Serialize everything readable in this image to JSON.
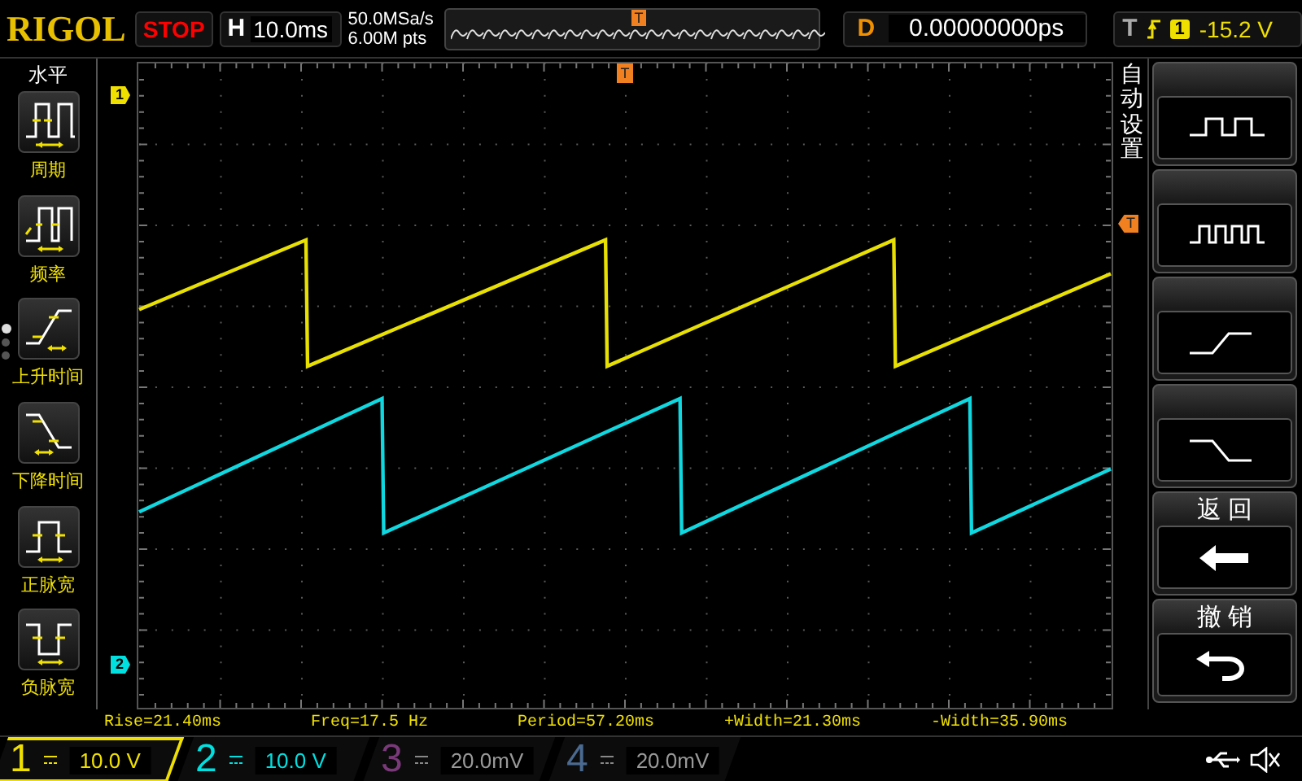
{
  "logo": "RIGOL",
  "run_state": {
    "label": "STOP"
  },
  "horizontal": {
    "label": "H",
    "value": "10.0ms"
  },
  "acquisition": {
    "sample_rate": "50.0MSa/s",
    "memory_depth": "6.00M pts"
  },
  "trigger_position_marker": "T",
  "delay": {
    "label": "D",
    "value": "0.00000000ps"
  },
  "trigger": {
    "label": "T",
    "source": "1",
    "level": "-15.2 V"
  },
  "left_menu": {
    "title": "水平",
    "page_dots": [
      {
        "selected": true
      },
      {
        "selected": false
      },
      {
        "selected": false
      }
    ],
    "items": [
      {
        "label": "周期",
        "kind": "period"
      },
      {
        "label": "频率",
        "kind": "frequency"
      },
      {
        "label": "上升时间",
        "kind": "rise"
      },
      {
        "label": "下降时间",
        "kind": "fall"
      },
      {
        "label": "正脉宽",
        "kind": "positive"
      },
      {
        "label": "负脉宽",
        "kind": "negative"
      }
    ]
  },
  "screen": {
    "channel_markers": [
      {
        "label": "1",
        "color": "#f0e000"
      },
      {
        "label": "2",
        "color": "#00e0e0"
      }
    ],
    "trigger_position_marker": "T"
  },
  "right_menu": {
    "title": "自动设置",
    "trigger_level_marker": "T",
    "keys": [
      {
        "kind": "single-pulse"
      },
      {
        "kind": "pulse-train"
      },
      {
        "kind": "rising-edge"
      },
      {
        "kind": "falling-edge"
      },
      {
        "kind": "back",
        "title": "返 回"
      },
      {
        "kind": "undo",
        "title": "撤 销"
      }
    ]
  },
  "measurements": [
    "Rise=21.40ms",
    "Freq=17.5 Hz",
    "Period=57.20ms",
    "+Width=21.30ms",
    "-Width=35.90ms"
  ],
  "channels": [
    {
      "number": "1",
      "value": "10.0 V",
      "color": "#f0e000",
      "enabled": true,
      "selected": true
    },
    {
      "number": "2",
      "value": "10.0 V",
      "color": "#00e0e0",
      "enabled": true,
      "selected": false
    },
    {
      "number": "3",
      "value": "20.0mV",
      "color": "#7a3a7a",
      "enabled": false,
      "selected": false
    },
    {
      "number": "4",
      "value": "20.0mV",
      "color": "#4a6a90",
      "enabled": false,
      "selected": false
    }
  ]
}
